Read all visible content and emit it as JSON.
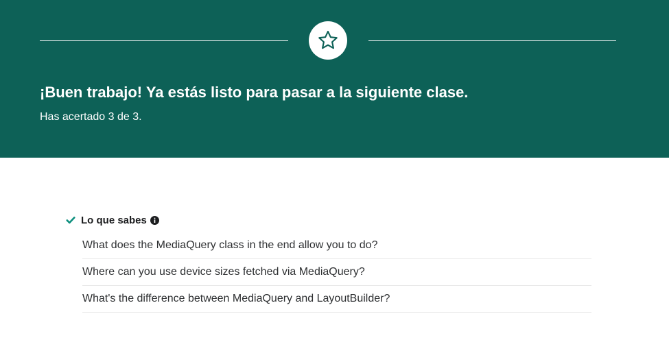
{
  "banner": {
    "headline": "¡Buen trabajo! Ya estás listo para pasar a la siguiente clase.",
    "score_text": "Has acertado 3 de 3.",
    "background_color": "#0d6157",
    "icon": "star-icon"
  },
  "knowledge": {
    "title": "Lo que sabes",
    "status_icon": "check-icon",
    "info_icon": "info-icon",
    "accent_color": "#0d8f7e",
    "questions": [
      "What does the MediaQuery class in the end allow you to do?",
      "Where can you use device sizes fetched via MediaQuery?",
      "What's the difference between MediaQuery and LayoutBuilder?"
    ]
  }
}
